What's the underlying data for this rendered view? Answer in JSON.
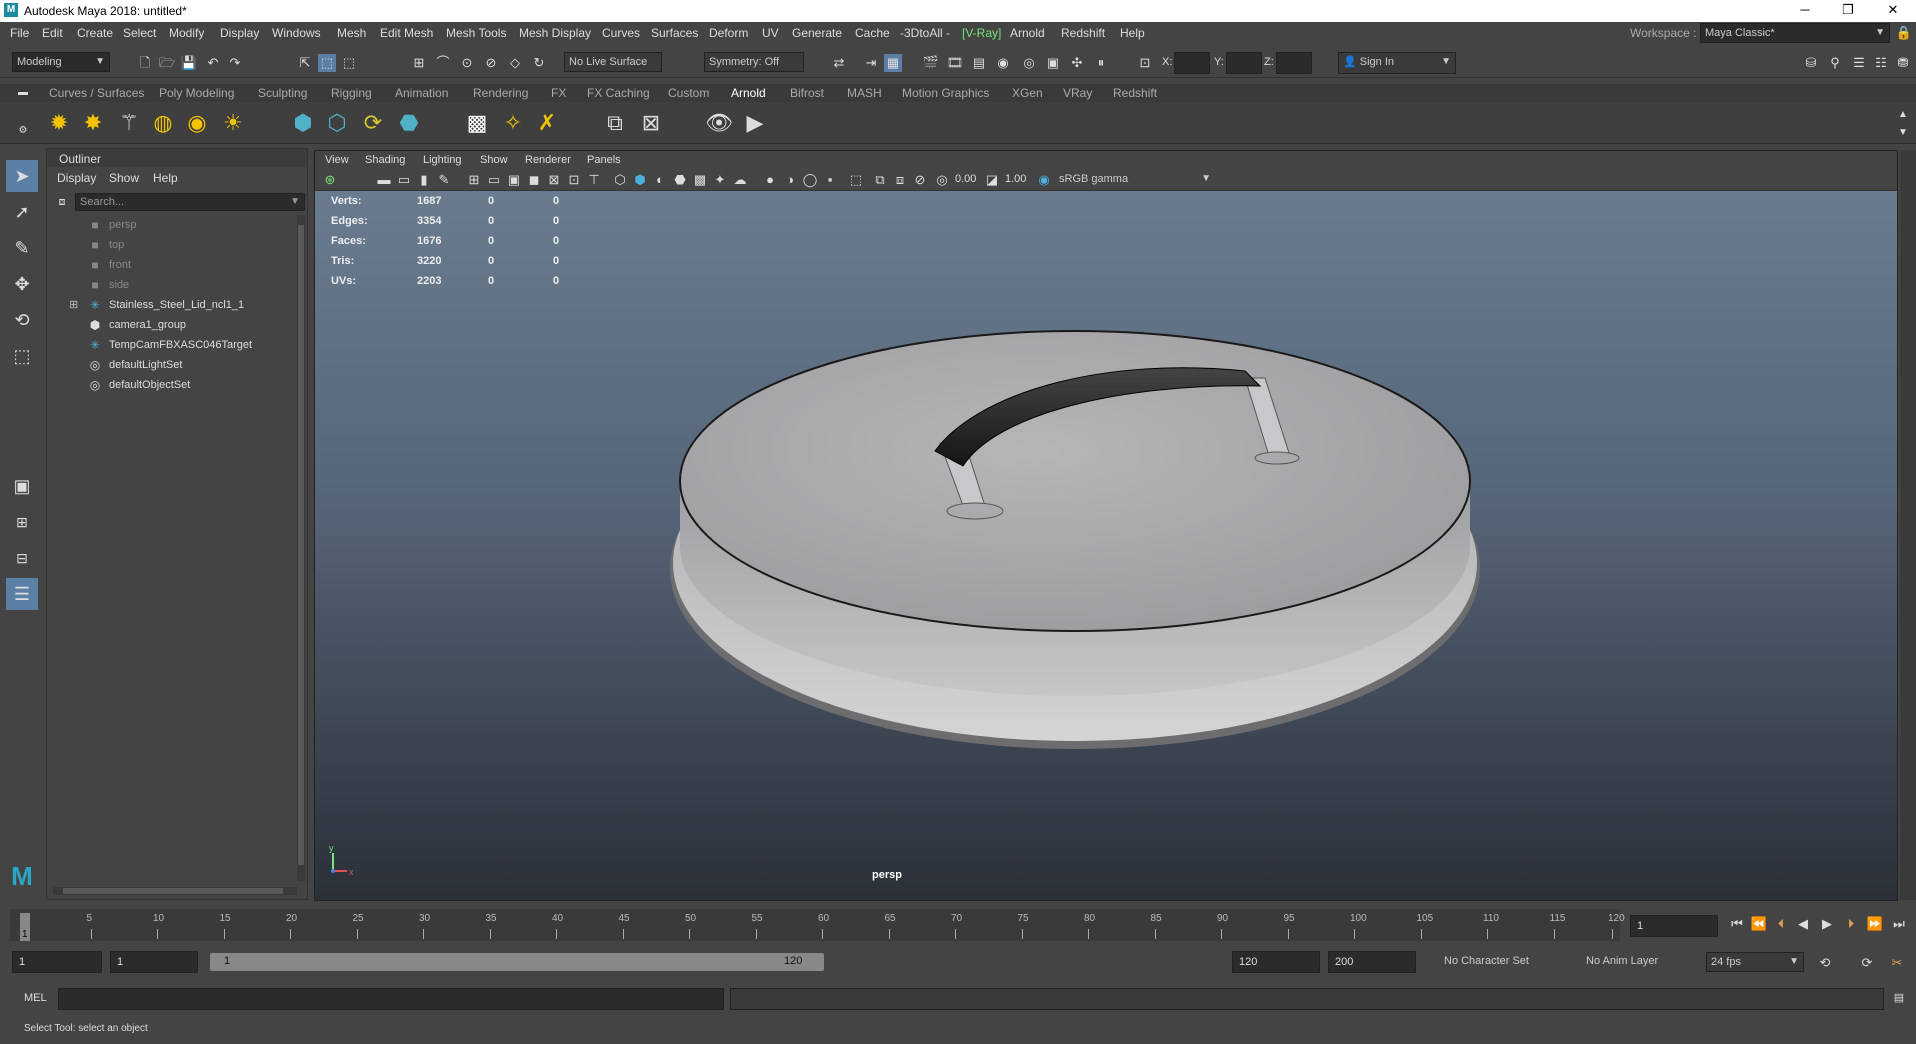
{
  "app": {
    "title": "Autodesk Maya 2018: untitled*",
    "logo": "M"
  },
  "window_controls": {
    "minimize": "─",
    "restore": "❐",
    "close": "✕"
  },
  "menubar": {
    "items": [
      "File",
      "Edit",
      "Create",
      "Select",
      "Modify",
      "Display",
      "Windows",
      "Mesh",
      "Edit Mesh",
      "Mesh Tools",
      "Mesh Display",
      "Curves",
      "Surfaces",
      "Deform",
      "UV",
      "Generate",
      "Cache",
      "-3DtoAll -"
    ],
    "vray": "[V-Ray]",
    "items2": [
      "Arnold",
      "Redshift",
      "Help"
    ],
    "workspace_label": "Workspace :",
    "workspace_value": "Maya Classic*"
  },
  "statusline": {
    "mode": "Modeling",
    "live_surface": "No Live Surface",
    "symmetry": "Symmetry: Off",
    "x_label": "X:",
    "y_label": "Y:",
    "z_label": "Z:",
    "sign_in": "Sign In"
  },
  "shelf_tabs": [
    "Curves / Surfaces",
    "Poly Modeling",
    "Sculpting",
    "Rigging",
    "Animation",
    "Rendering",
    "FX",
    "FX Caching",
    "Custom",
    "Arnold",
    "Bifrost",
    "MASH",
    "Motion Graphics",
    "XGen",
    "VRay",
    "Redshift"
  ],
  "active_shelf": "Arnold",
  "outliner": {
    "title": "Outliner",
    "menu": [
      "Display",
      "Show",
      "Help"
    ],
    "search_placeholder": "Search...",
    "items": [
      {
        "label": "persp",
        "icon": "camera-icon",
        "dim": true
      },
      {
        "label": "top",
        "icon": "camera-icon",
        "dim": true
      },
      {
        "label": "front",
        "icon": "camera-icon",
        "dim": true
      },
      {
        "label": "side",
        "icon": "camera-icon",
        "dim": true
      },
      {
        "label": "Stainless_Steel_Lid_ncl1_1",
        "icon": "group-node-icon",
        "dim": false,
        "expander": "⊞"
      },
      {
        "label": "camera1_group",
        "icon": "group-icon",
        "dim": false
      },
      {
        "label": "TempCamFBXASC046Target",
        "icon": "target-node-icon",
        "dim": false
      },
      {
        "label": "defaultLightSet",
        "icon": "set-icon",
        "dim": false
      },
      {
        "label": "defaultObjectSet",
        "icon": "set-icon",
        "dim": false
      }
    ]
  },
  "viewport": {
    "menu": [
      "View",
      "Shading",
      "Lighting",
      "Show",
      "Renderer",
      "Panels"
    ],
    "exposure": "0.00",
    "gamma": "1.00",
    "color_space": "sRGB gamma",
    "camera_label": "persp",
    "axis": {
      "y": "y",
      "x": "x"
    },
    "hud": [
      {
        "label": "Verts:",
        "v1": "1687",
        "v2": "0",
        "v3": "0"
      },
      {
        "label": "Edges:",
        "v1": "3354",
        "v2": "0",
        "v3": "0"
      },
      {
        "label": "Faces:",
        "v1": "1676",
        "v2": "0",
        "v3": "0"
      },
      {
        "label": "Tris:",
        "v1": "3220",
        "v2": "0",
        "v3": "0"
      },
      {
        "label": "UVs:",
        "v1": "2203",
        "v2": "0",
        "v3": "0"
      }
    ]
  },
  "timeline": {
    "ticks": [
      "5",
      "10",
      "15",
      "20",
      "25",
      "30",
      "35",
      "40",
      "45",
      "50",
      "55",
      "60",
      "65",
      "70",
      "75",
      "80",
      "85",
      "90",
      "95",
      "100",
      "105",
      "110",
      "115",
      "120"
    ],
    "current_marker": "1",
    "current_frame": "1"
  },
  "range": {
    "start": "1",
    "playback_start": "1",
    "slider_start": "1",
    "slider_end": "120",
    "playback_end": "120",
    "end": "200",
    "character_set": "No Character Set",
    "anim_layer": "No Anim Layer",
    "fps": "24 fps"
  },
  "command": {
    "label": "MEL"
  },
  "help_line": "Select Tool: select an object"
}
